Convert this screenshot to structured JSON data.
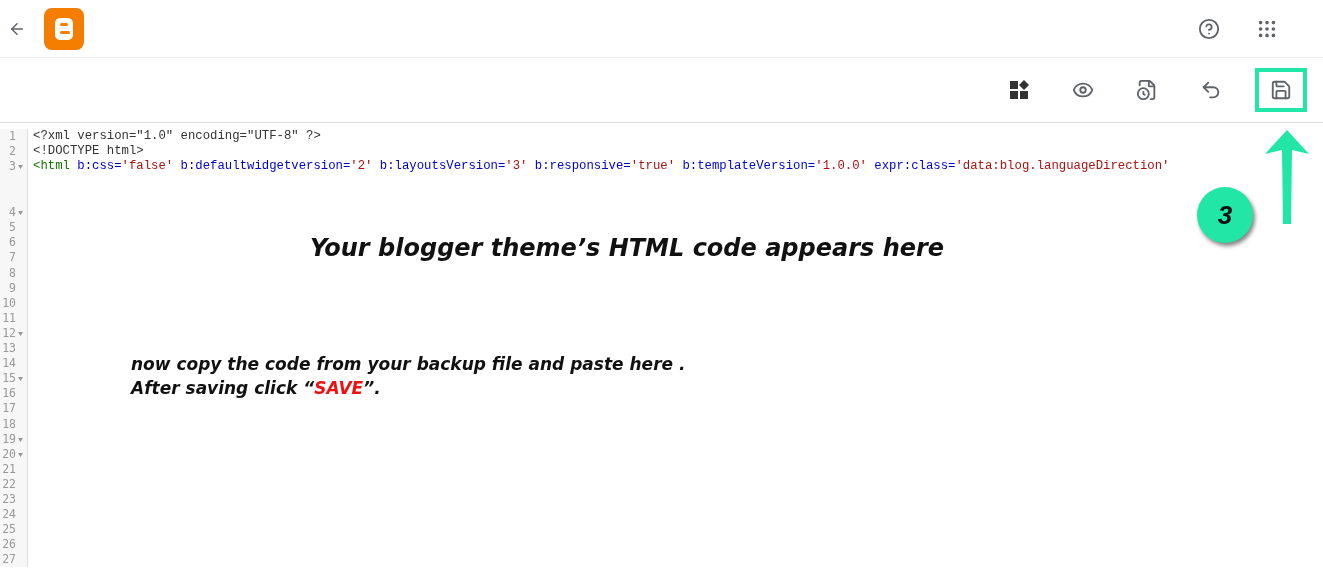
{
  "toolbar": {
    "save_highlighted": true
  },
  "editor": {
    "lines": [
      {
        "number": "1",
        "fold": false,
        "wrapped": false,
        "tokens": [
          {
            "kind": "plain",
            "text": "<?xml version=\"1.0\" encoding=\"UTF-8\" ?>"
          }
        ]
      },
      {
        "number": "2",
        "fold": false,
        "wrapped": false,
        "tokens": [
          {
            "kind": "plain",
            "text": "<!DOCTYPE html>"
          }
        ]
      },
      {
        "number": "3",
        "fold": true,
        "wrapped": true,
        "tokens": [
          {
            "kind": "tag",
            "text": "<html"
          },
          {
            "kind": "attr",
            "text": " b:css="
          },
          {
            "kind": "value",
            "text": "'false'"
          },
          {
            "kind": "attr",
            "text": " b:defaultwidgetversion="
          },
          {
            "kind": "value",
            "text": "'2'"
          },
          {
            "kind": "attr",
            "text": " b:layoutsVersion="
          },
          {
            "kind": "value",
            "text": "'3'"
          },
          {
            "kind": "attr",
            "text": " b:responsive="
          },
          {
            "kind": "value",
            "text": "'true'"
          },
          {
            "kind": "attr",
            "text": " b:templateVersion="
          },
          {
            "kind": "value",
            "text": "'1.0.0'"
          },
          {
            "kind": "attr",
            "text": " expr:class="
          },
          {
            "kind": "value",
            "text": "'data:blog.languageDirection'"
          }
        ]
      },
      {
        "number": "4",
        "fold": true,
        "wrapped": false
      },
      {
        "number": "5",
        "fold": false,
        "wrapped": false
      },
      {
        "number": "6",
        "fold": false,
        "wrapped": false
      },
      {
        "number": "7",
        "fold": false,
        "wrapped": false
      },
      {
        "number": "8",
        "fold": false,
        "wrapped": false
      },
      {
        "number": "9",
        "fold": false,
        "wrapped": false
      },
      {
        "number": "10",
        "fold": false,
        "wrapped": false
      },
      {
        "number": "11",
        "fold": false,
        "wrapped": false
      },
      {
        "number": "12",
        "fold": true,
        "wrapped": false
      },
      {
        "number": "13",
        "fold": false,
        "wrapped": false
      },
      {
        "number": "14",
        "fold": false,
        "wrapped": false
      },
      {
        "number": "15",
        "fold": true,
        "wrapped": false
      },
      {
        "number": "16",
        "fold": false,
        "wrapped": false
      },
      {
        "number": "17",
        "fold": false,
        "wrapped": false
      },
      {
        "number": "18",
        "fold": false,
        "wrapped": false
      },
      {
        "number": "19",
        "fold": true,
        "wrapped": false
      },
      {
        "number": "20",
        "fold": true,
        "wrapped": false
      },
      {
        "number": "21",
        "fold": false,
        "wrapped": false
      },
      {
        "number": "22",
        "fold": false,
        "wrapped": false
      },
      {
        "number": "23",
        "fold": false,
        "wrapped": false
      },
      {
        "number": "24",
        "fold": false,
        "wrapped": false
      },
      {
        "number": "25",
        "fold": false,
        "wrapped": false
      },
      {
        "number": "26",
        "fold": false,
        "wrapped": false
      },
      {
        "number": "27",
        "fold": false,
        "wrapped": false
      }
    ]
  },
  "annotations": {
    "headline": "Your blogger theme’s HTML code appears here",
    "instructions": [
      [
        {
          "text": "now copy the code from your backup file and paste here .",
          "emphasis": false
        }
      ],
      [
        {
          "text": "After saving click “",
          "emphasis": false
        },
        {
          "text": "SAVE",
          "emphasis": true
        },
        {
          "text": "”.",
          "emphasis": false
        }
      ]
    ],
    "step_badge": "3"
  }
}
